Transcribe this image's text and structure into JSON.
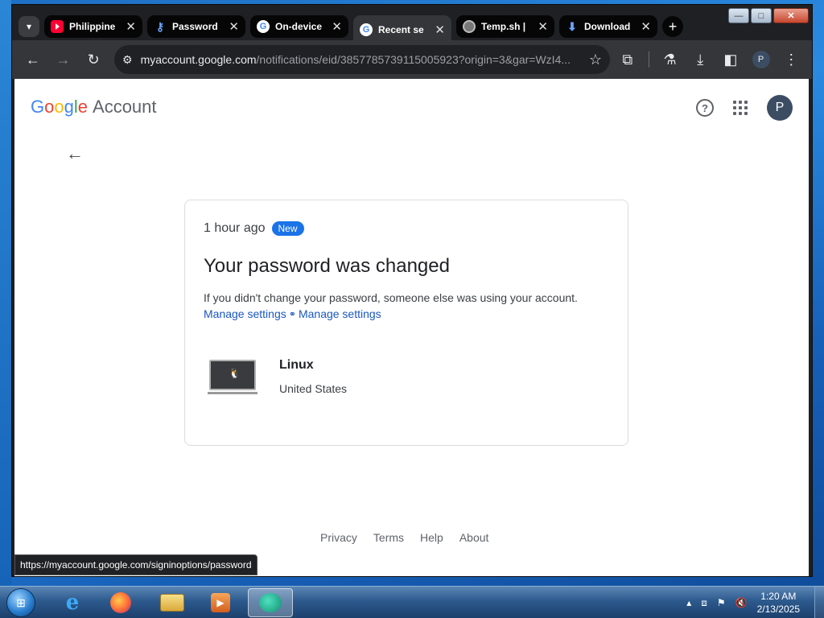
{
  "browser": {
    "tabs": [
      {
        "title": "Philippine",
        "favicon": "youtube-icon",
        "active": false
      },
      {
        "title": "Password",
        "favicon": "key-icon",
        "active": false
      },
      {
        "title": "On-device",
        "favicon": "google-icon",
        "active": false
      },
      {
        "title": "Recent se",
        "favicon": "google-icon",
        "active": true
      },
      {
        "title": "Temp.sh |",
        "favicon": "globe-icon",
        "active": false
      },
      {
        "title": "Download",
        "favicon": "download-icon",
        "active": false
      }
    ],
    "url_host": "myaccount.google.com",
    "url_path": "/notifications/eid/3857785739115005923?origin=3&gar=WzI4...",
    "profile_initial": "P",
    "window_controls": {
      "minimize": "—",
      "maximize": "□",
      "close": "✕"
    }
  },
  "page": {
    "logo_letters": [
      {
        "ch": "G",
        "color": "#4285f4"
      },
      {
        "ch": "o",
        "color": "#ea4335"
      },
      {
        "ch": "o",
        "color": "#fbbc05"
      },
      {
        "ch": "g",
        "color": "#4285f4"
      },
      {
        "ch": "l",
        "color": "#34a853"
      },
      {
        "ch": "e",
        "color": "#ea4335"
      }
    ],
    "logo_suffix": "Account",
    "avatar_initial": "P",
    "card": {
      "time": "1 hour ago",
      "badge": "New",
      "title": "Your password was changed",
      "description": "If you didn't change your password, someone else was using your account.",
      "link_1": "Manage settings",
      "link_2": "Manage settings",
      "device_name": "Linux",
      "device_location": "United States"
    },
    "footer_links": [
      "Privacy",
      "Terms",
      "Help",
      "About"
    ],
    "status_url": "https://myaccount.google.com/signinoptions/password"
  },
  "taskbar": {
    "apps": [
      "internet-explorer-icon",
      "firefox-icon",
      "file-explorer-icon",
      "media-player-icon",
      "chat-app-icon"
    ],
    "time": "1:20 AM",
    "date": "2/13/2025"
  }
}
